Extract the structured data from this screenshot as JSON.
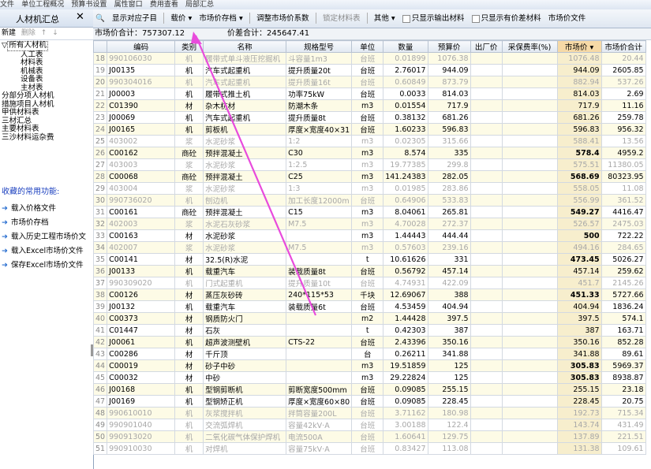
{
  "topbar": {
    "items": [
      "文件",
      "单位工程概况",
      "预算书设置",
      "属性窗口",
      "费用查看",
      "局部汇总"
    ]
  },
  "left_panel": {
    "title": "人材机汇总",
    "close": "✕",
    "tools": {
      "new": "新建",
      "delete": "删除",
      "up": "↑",
      "down": "↓"
    },
    "tree": [
      {
        "label": "所有人材机",
        "level": 0,
        "toggle": "▽"
      },
      {
        "label": "人工表",
        "level": 1
      },
      {
        "label": "材料表",
        "level": 1
      },
      {
        "label": "机械表",
        "level": 1
      },
      {
        "label": "设备表",
        "level": 1
      },
      {
        "label": "主材表",
        "level": 1
      },
      {
        "label": "分部分项人材机",
        "level": 0
      },
      {
        "label": "措施项目人材机",
        "level": 0
      },
      {
        "label": "甲供材料表",
        "level": 0
      },
      {
        "label": "三材汇总",
        "level": 0
      },
      {
        "label": "主要材料表",
        "level": 0
      },
      {
        "label": "三沙材料运杂费",
        "level": 0
      }
    ],
    "fav_title": "收藏的常用功能:",
    "fav_items": [
      "载入价格文件",
      "市场价存档",
      "载入历史工程市场价文",
      "载入Excel市场价文件",
      "保存Excel市场价文件"
    ]
  },
  "toolbar": {
    "find": "🔍",
    "show_sub": "显示对应子目",
    "price": "载价",
    "market_save": "市场价存档",
    "adjust": "调整市场价系数",
    "lock": "锁定材料表",
    "other": "其他",
    "only_output": "只显示输出材料",
    "only_diff": "只显示有价差材料",
    "price_file": "市场价文件"
  },
  "summary": {
    "market_total_label": "市场价合计：",
    "market_total": "757307.12",
    "diff_total_label": "价差合计：",
    "diff_total": "245647.41"
  },
  "columns": [
    "编码",
    "类别",
    "名称",
    "规格型号",
    "单位",
    "数量",
    "预算价",
    "出厂价",
    "采保费率(%)",
    "市场价",
    "市场价合计"
  ],
  "rows": [
    {
      "no": "18",
      "code": "990106030",
      "cat": "机",
      "name": "履带式单斗液压挖掘机",
      "spec": "斗容量1m3",
      "unit": "台班",
      "qty": "0.01899",
      "budget": "1076.38",
      "market": "1076.48",
      "total": "20.44",
      "dim": true
    },
    {
      "no": "19",
      "code": "J00135",
      "cat": "机",
      "name": "汽车式起重机",
      "spec": "提升质量20t",
      "unit": "台班",
      "qty": "2.76017",
      "budget": "944.09",
      "market": "944.09",
      "total": "2605.85",
      "dim": false
    },
    {
      "no": "20",
      "code": "990304016",
      "cat": "机",
      "name": "汽车式起重机",
      "spec": "提升质量16t",
      "unit": "台班",
      "qty": "0.60849",
      "budget": "873.79",
      "market": "882.94",
      "total": "537.26",
      "dim": true
    },
    {
      "no": "21",
      "code": "J00003",
      "cat": "机",
      "name": "履带式推土机",
      "spec": "功率75kW",
      "unit": "台班",
      "qty": "0.0033",
      "budget": "814.03",
      "market": "814.03",
      "total": "2.69",
      "dim": false
    },
    {
      "no": "22",
      "code": "C01390",
      "cat": "材",
      "name": "杂木枋材",
      "spec": "防潮木条",
      "unit": "m3",
      "qty": "0.01554",
      "budget": "717.9",
      "market": "717.9",
      "total": "11.16",
      "dim": false
    },
    {
      "no": "23",
      "code": "J00069",
      "cat": "机",
      "name": "汽车式起重机",
      "spec": "提升质量8t",
      "unit": "台班",
      "qty": "0.38132",
      "budget": "681.26",
      "market": "681.26",
      "total": "259.78",
      "dim": false
    },
    {
      "no": "24",
      "code": "J00165",
      "cat": "机",
      "name": "剪板机",
      "spec": "厚度×宽度40×31",
      "unit": "台班",
      "qty": "1.60233",
      "budget": "596.83",
      "market": "596.83",
      "total": "956.32",
      "dim": false
    },
    {
      "no": "25",
      "code": "403002",
      "cat": "浆",
      "name": "水泥砂浆",
      "spec": "1:2",
      "unit": "m3",
      "qty": "0.02305",
      "budget": "315.66",
      "market": "588.41",
      "total": "13.56",
      "dim": true
    },
    {
      "no": "26",
      "code": "C00162",
      "cat": "商砼",
      "name": "预拌混凝土",
      "spec": "C30",
      "unit": "m3",
      "qty": "8.574",
      "budget": "335",
      "market": "578.4",
      "total": "4959.2",
      "dim": false,
      "bold": true
    },
    {
      "no": "27",
      "code": "403003",
      "cat": "浆",
      "name": "水泥砂浆",
      "spec": "1:2.5",
      "unit": "m3",
      "qty": "19.77385",
      "budget": "299.8",
      "market": "575.51",
      "total": "11380.05",
      "dim": true
    },
    {
      "no": "28",
      "code": "C00068",
      "cat": "商砼",
      "name": "预拌混凝土",
      "spec": "C25",
      "unit": "m3",
      "qty": "141.24383",
      "budget": "282.05",
      "market": "568.69",
      "total": "80323.95",
      "dim": false,
      "bold": true
    },
    {
      "no": "29",
      "code": "403004",
      "cat": "浆",
      "name": "水泥砂浆",
      "spec": "1:3",
      "unit": "m3",
      "qty": "0.01985",
      "budget": "283.86",
      "market": "558.05",
      "total": "11.08",
      "dim": true
    },
    {
      "no": "30",
      "code": "990736020",
      "cat": "机",
      "name": "刨边机",
      "spec": "加工长度12000m",
      "unit": "台班",
      "qty": "0.64906",
      "budget": "533.83",
      "market": "556.99",
      "total": "361.52",
      "dim": true
    },
    {
      "no": "31",
      "code": "C00161",
      "cat": "商砼",
      "name": "预拌混凝土",
      "spec": "C15",
      "unit": "m3",
      "qty": "8.04061",
      "budget": "265.81",
      "market": "549.27",
      "total": "4416.47",
      "dim": false,
      "bold": true
    },
    {
      "no": "32",
      "code": "402003",
      "cat": "浆",
      "name": "水泥石灰砂浆",
      "spec": "M7.5",
      "unit": "m3",
      "qty": "4.70028",
      "budget": "272.37",
      "market": "526.57",
      "total": "2475.03",
      "dim": true
    },
    {
      "no": "33",
      "code": "C00163",
      "cat": "材",
      "name": "水泥砂浆",
      "spec": "",
      "unit": "m3",
      "qty": "1.44443",
      "budget": "444.44",
      "market": "500",
      "total": "722.22",
      "dim": false,
      "bold": true
    },
    {
      "no": "34",
      "code": "402007",
      "cat": "浆",
      "name": "水泥砂浆",
      "spec": "M7.5",
      "unit": "m3",
      "qty": "0.57603",
      "budget": "239.16",
      "market": "494.16",
      "total": "284.65",
      "dim": true
    },
    {
      "no": "35",
      "code": "C00141",
      "cat": "材",
      "name": "32.5(R)水泥",
      "spec": "",
      "unit": "t",
      "qty": "10.61626",
      "budget": "331",
      "market": "473.45",
      "total": "5026.27",
      "dim": false,
      "bold": true
    },
    {
      "no": "36",
      "code": "J00133",
      "cat": "机",
      "name": "载重汽车",
      "spec": "装载质量8t",
      "unit": "台班",
      "qty": "0.56792",
      "budget": "457.14",
      "market": "457.14",
      "total": "259.62",
      "dim": false
    },
    {
      "no": "37",
      "code": "990309020",
      "cat": "机",
      "name": "门式起重机",
      "spec": "提升质量10t",
      "unit": "台班",
      "qty": "4.74931",
      "budget": "422.09",
      "market": "451.7",
      "total": "2145.26",
      "dim": true
    },
    {
      "no": "38",
      "code": "C00126",
      "cat": "材",
      "name": "蒸压灰砂砖",
      "spec": "240*115*53",
      "unit": "千块",
      "qty": "12.69067",
      "budget": "388",
      "market": "451.33",
      "total": "5727.66",
      "dim": false,
      "bold": true
    },
    {
      "no": "39",
      "code": "J00132",
      "cat": "机",
      "name": "载重汽车",
      "spec": "装载质量6t",
      "unit": "台班",
      "qty": "4.53459",
      "budget": "404.94",
      "market": "404.94",
      "total": "1836.24",
      "dim": false
    },
    {
      "no": "40",
      "code": "C00373",
      "cat": "材",
      "name": "钢质防火门",
      "spec": "",
      "unit": "m2",
      "qty": "1.44428",
      "budget": "397.5",
      "market": "397.5",
      "total": "574.1",
      "dim": false
    },
    {
      "no": "41",
      "code": "C01447",
      "cat": "材",
      "name": "石灰",
      "spec": "",
      "unit": "t",
      "qty": "0.42303",
      "budget": "387",
      "market": "387",
      "total": "163.71",
      "dim": false
    },
    {
      "no": "42",
      "code": "J00061",
      "cat": "机",
      "name": "超声波测壁机",
      "spec": "CTS-22",
      "unit": "台班",
      "qty": "2.43396",
      "budget": "350.16",
      "market": "350.16",
      "total": "852.28",
      "dim": false
    },
    {
      "no": "43",
      "code": "C00286",
      "cat": "材",
      "name": "千斤顶",
      "spec": "",
      "unit": "台",
      "qty": "0.26211",
      "budget": "341.88",
      "market": "341.88",
      "total": "89.61",
      "dim": false
    },
    {
      "no": "44",
      "code": "C00019",
      "cat": "材",
      "name": "砂子中砂",
      "spec": "",
      "unit": "m3",
      "qty": "19.51859",
      "budget": "125",
      "market": "305.83",
      "total": "5969.37",
      "dim": false,
      "bold": true
    },
    {
      "no": "45",
      "code": "C00032",
      "cat": "材",
      "name": "中砂",
      "spec": "",
      "unit": "m3",
      "qty": "29.22824",
      "budget": "125",
      "market": "305.83",
      "total": "8938.87",
      "dim": false,
      "bold": true
    },
    {
      "no": "46",
      "code": "J00168",
      "cat": "机",
      "name": "型钢剪断机",
      "spec": "剪断宽度500mm",
      "unit": "台班",
      "qty": "0.09085",
      "budget": "255.15",
      "market": "255.15",
      "total": "23.18",
      "dim": false
    },
    {
      "no": "47",
      "code": "J00169",
      "cat": "机",
      "name": "型钢矫正机",
      "spec": "厚度×宽度60×80",
      "unit": "台班",
      "qty": "0.09085",
      "budget": "228.45",
      "market": "228.45",
      "total": "20.75",
      "dim": false
    },
    {
      "no": "48",
      "code": "990610010",
      "cat": "机",
      "name": "灰浆搅拌机",
      "spec": "拌筒容量200L",
      "unit": "台班",
      "qty": "3.71162",
      "budget": "180.98",
      "market": "192.73",
      "total": "715.34",
      "dim": true
    },
    {
      "no": "49",
      "code": "990901040",
      "cat": "机",
      "name": "交流弧焊机",
      "spec": "容量42kV·A",
      "unit": "台班",
      "qty": "3.00188",
      "budget": "122.4",
      "market": "143.74",
      "total": "431.49",
      "dim": true
    },
    {
      "no": "50",
      "code": "990913020",
      "cat": "机",
      "name": "二氧化碳气体保护焊机",
      "spec": "电流500A",
      "unit": "台班",
      "qty": "1.60641",
      "budget": "129.75",
      "market": "137.89",
      "total": "221.51",
      "dim": true
    },
    {
      "no": "51",
      "code": "990910030",
      "cat": "机",
      "name": "对焊机",
      "spec": "容量75kV·A",
      "unit": "台班",
      "qty": "0.83427",
      "budget": "113.08",
      "market": "131.38",
      "total": "109.61",
      "dim": true
    }
  ]
}
